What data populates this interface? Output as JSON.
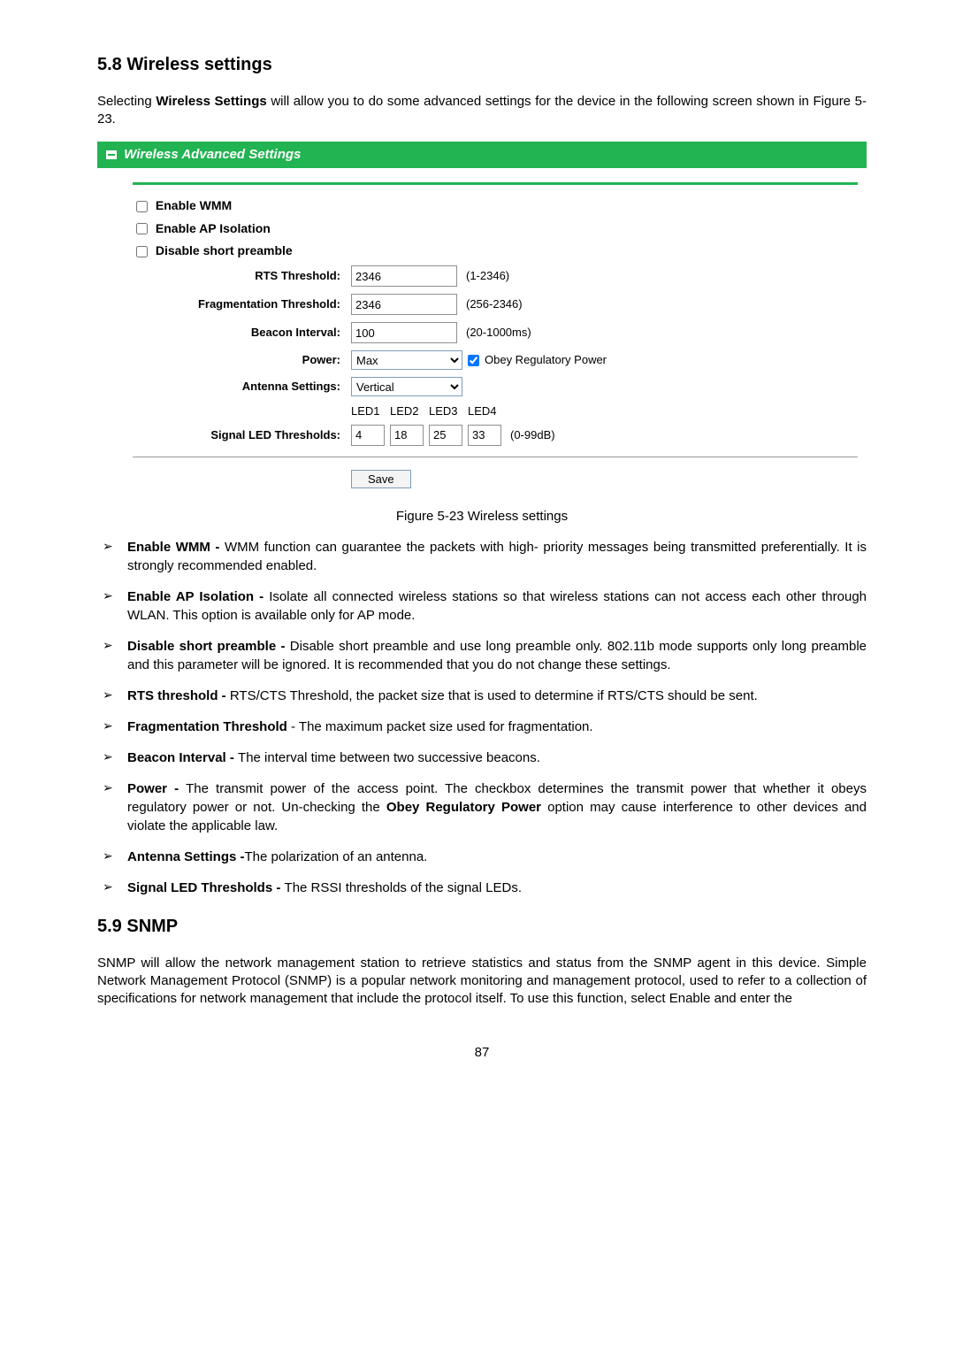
{
  "section1": {
    "title": "5.8    Wireless settings",
    "intro_before": "Selecting ",
    "intro_bold": "Wireless Settings",
    "intro_after": " will allow you to do some advanced settings for the device in the following screen shown in Figure 5-23."
  },
  "panel": {
    "header": "Wireless Advanced Settings",
    "chk1": "Enable WMM",
    "chk2": "Enable AP Isolation",
    "chk3": "Disable short preamble",
    "rts_label": "RTS Threshold:",
    "rts_value": "2346",
    "rts_hint": "(1-2346)",
    "frag_label": "Fragmentation Threshold:",
    "frag_value": "2346",
    "frag_hint": "(256-2346)",
    "beacon_label": "Beacon Interval:",
    "beacon_value": "100",
    "beacon_hint": "(20-1000ms)",
    "power_label": "Power:",
    "power_value": "Max",
    "obey_label": "Obey Regulatory Power",
    "antenna_label": "Antenna Settings:",
    "antenna_value": "Vertical",
    "led_label": "Signal LED Thresholds:",
    "led_h1": "LED1",
    "led_h2": "LED2",
    "led_h3": "LED3",
    "led_h4": "LED4",
    "led1": "4",
    "led2": "18",
    "led3": "25",
    "led4": "33",
    "led_hint": "(0-99dB)",
    "save": "Save"
  },
  "caption": "Figure 5-23 Wireless settings",
  "bullets": {
    "b1": {
      "t": "Enable WMM - ",
      "d": "WMM function can guarantee the packets with high- priority messages being transmitted preferentially. It is strongly recommended enabled."
    },
    "b2": {
      "t": "Enable AP Isolation - ",
      "d": "Isolate all connected wireless stations so that wireless stations can not access each other through WLAN. This option is available only for AP mode."
    },
    "b3": {
      "t": "Disable short preamble - ",
      "d": "Disable short preamble and use long preamble only. 802.11b mode supports only long preamble and this parameter will be ignored. It is recommended that you do not change these settings."
    },
    "b4": {
      "t": "RTS threshold - ",
      "d": "RTS/CTS Threshold, the packet size that is used to determine if RTS/CTS should be sent."
    },
    "b5": {
      "t": "Fragmentation Threshold",
      "d": " - The maximum packet size used for fragmentation."
    },
    "b6": {
      "t": "Beacon Interval - ",
      "d": "The interval time between two successive beacons."
    },
    "b7": {
      "t": "Power - ",
      "d1": "The transmit power of the access point. The checkbox determines the transmit power that whether it obeys regulatory power or not. Un-checking the ",
      "bold": "Obey Regulatory Power",
      "d2": " option may cause interference to other devices and violate the applicable law."
    },
    "b8": {
      "t": "Antenna Settings -",
      "d": "The polarization of an antenna."
    },
    "b9": {
      "t": "Signal LED Thresholds - ",
      "d": "The RSSI thresholds of the signal LEDs."
    }
  },
  "section2": {
    "title": "5.9    SNMP",
    "para": "SNMP will allow the network management station to retrieve statistics and status from the SNMP agent in this device. Simple Network Management Protocol (SNMP) is a popular network monitoring and management protocol, used to refer to a collection of specifications for network management that include the protocol itself. To use this function, select Enable and enter the"
  },
  "page": "87"
}
